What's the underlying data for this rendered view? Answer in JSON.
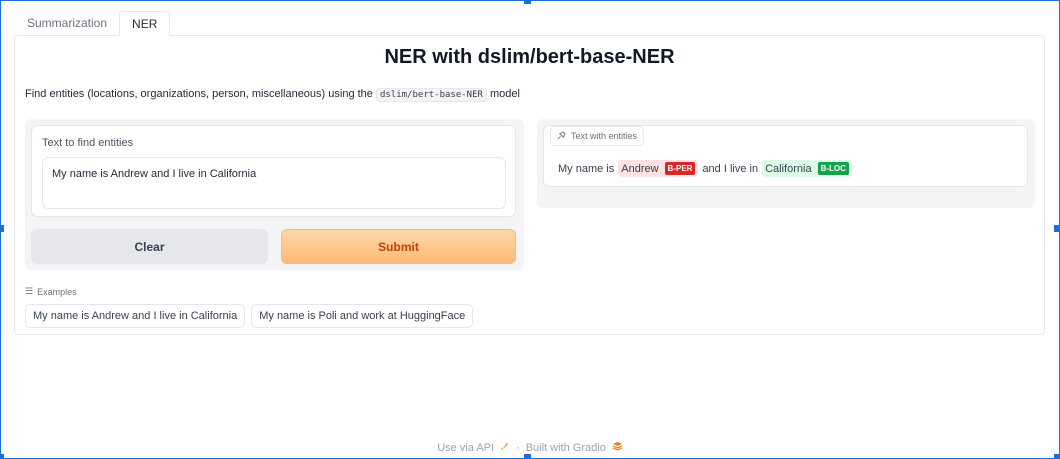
{
  "tabs": [
    {
      "label": "Summarization",
      "active": false
    },
    {
      "label": "NER",
      "active": true
    }
  ],
  "title": "NER with dslim/bert-base-NER",
  "description": {
    "before": "Find entities (locations, organizations, person, miscellaneous) using the ",
    "code": "dslim/bert-base-NER",
    "after": " model"
  },
  "input": {
    "label": "Text to find entities",
    "value": "My name is Andrew and I live in California"
  },
  "buttons": {
    "clear": "Clear",
    "submit": "Submit"
  },
  "output": {
    "label": "Text with entities",
    "segments": {
      "t1": "My name is",
      "e1": "Andrew",
      "e1_tag": "B-PER",
      "t2": "and I live in",
      "e2": "California",
      "e2_tag": "B-LOC"
    }
  },
  "examples": {
    "label": "Examples",
    "items": [
      "My name is Andrew and I live in California",
      "My name is Poli and work at HuggingFace"
    ]
  },
  "footer": {
    "api": "Use via API",
    "sep": "·",
    "built": "Built with Gradio"
  },
  "colors": {
    "accent": "#f97316",
    "per_tag": "#dc2626",
    "loc_tag": "#16a34a",
    "selection": "#1a6fd8"
  }
}
